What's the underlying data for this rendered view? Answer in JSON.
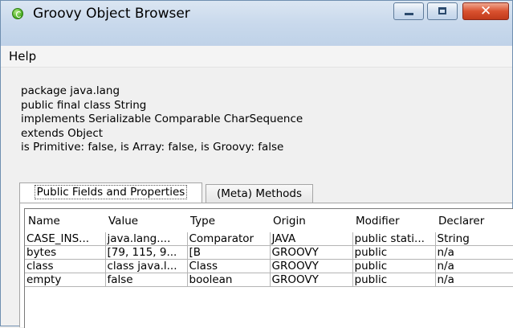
{
  "window": {
    "title": "Groovy Object Browser",
    "icon": "groovy-icon",
    "controls": [
      "minimize",
      "maximize",
      "close"
    ]
  },
  "menu": {
    "items": [
      "Help"
    ]
  },
  "info": {
    "lines": [
      "package java.lang",
      "public final class String",
      "implements Serializable Comparable CharSequence",
      "extends Object",
      "is Primitive: false, is Array: false, is Groovy: false"
    ]
  },
  "tabs": [
    {
      "label": "Public Fields and Properties",
      "selected": true
    },
    {
      "label": "(Meta) Methods",
      "selected": false
    }
  ],
  "table": {
    "columns": [
      "Name",
      "Value",
      "Type",
      "Origin",
      "Modifier",
      "Declarer"
    ],
    "rows": [
      [
        "CASE_INS...",
        "java.lang....",
        "Comparator",
        "JAVA",
        "public stati...",
        "String"
      ],
      [
        "bytes",
        "[79, 115, 9...",
        "[B",
        "GROOVY",
        "public",
        "n/a"
      ],
      [
        "class",
        "class java.l...",
        "Class",
        "GROOVY",
        "public",
        "n/a"
      ],
      [
        "empty",
        "false",
        "boolean",
        "GROOVY",
        "public",
        "n/a"
      ]
    ]
  },
  "colors": {
    "window_background": "#f0f0f0",
    "titlebar": "#c9d9ec",
    "close_button": "#d9512f"
  }
}
